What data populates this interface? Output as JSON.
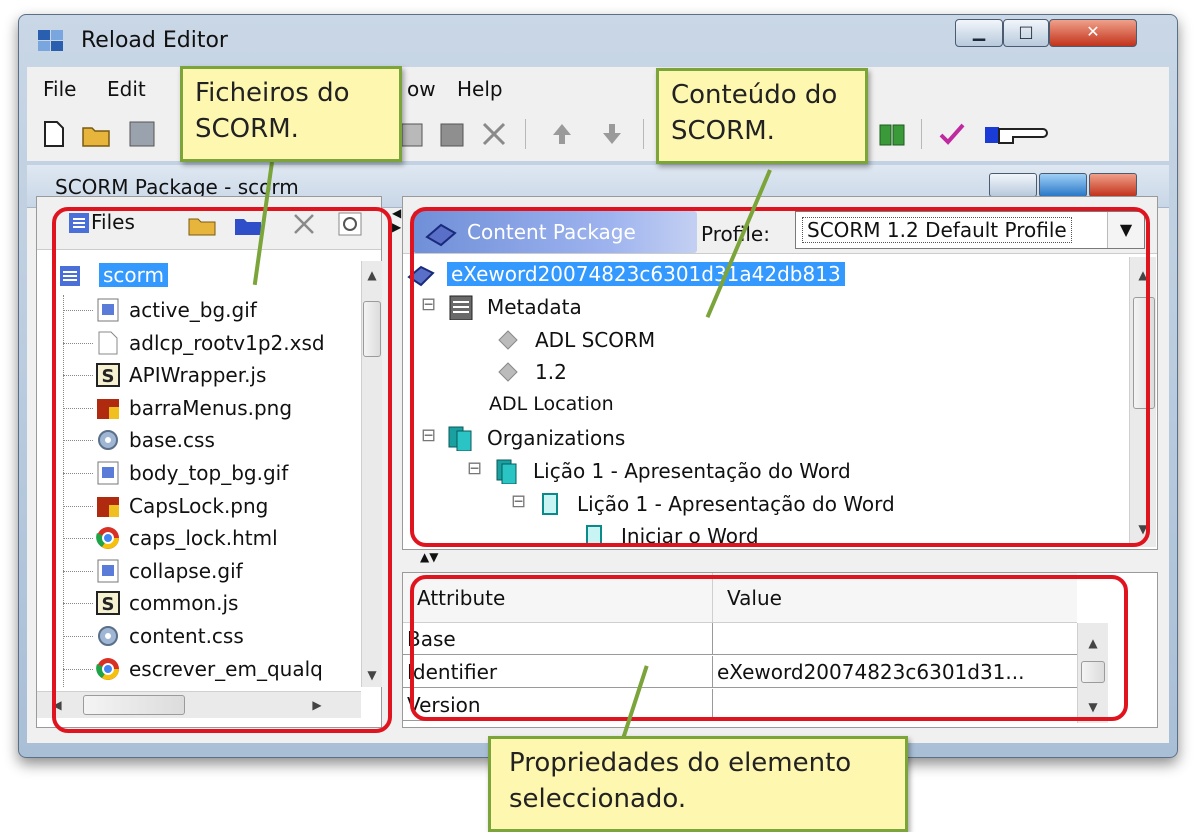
{
  "window": {
    "title": "Reload Editor"
  },
  "menu": {
    "file": "File",
    "edit": "Edit",
    "window_partial": "ow",
    "help": "Help"
  },
  "child_window": {
    "title": "SCORM Package - scorm"
  },
  "files": {
    "label": "Files",
    "root": "scorm",
    "items": [
      {
        "name": "active_bg.gif",
        "icon": "image-file-icon"
      },
      {
        "name": "adlcp_rootv1p2.xsd",
        "icon": "blank-file-icon"
      },
      {
        "name": "APIWrapper.js",
        "icon": "script-file-icon"
      },
      {
        "name": "barraMenus.png",
        "icon": "png-file-icon"
      },
      {
        "name": "base.css",
        "icon": "css-file-icon"
      },
      {
        "name": "body_top_bg.gif",
        "icon": "image-file-icon"
      },
      {
        "name": "CapsLock.png",
        "icon": "png-file-icon"
      },
      {
        "name": "caps_lock.html",
        "icon": "chrome-html-icon"
      },
      {
        "name": "collapse.gif",
        "icon": "image-file-icon"
      },
      {
        "name": "common.js",
        "icon": "script-file-icon"
      },
      {
        "name": "content.css",
        "icon": "css-file-icon"
      },
      {
        "name": "escrever_em_qualq",
        "icon": "chrome-html-icon"
      }
    ]
  },
  "content_package": {
    "tab_label": "Content Package",
    "profile_label": "Profile:",
    "profile_value": "SCORM 1.2 Default Profile",
    "tree": [
      {
        "label": "eXeword20074823c6301d31a42db813",
        "selected": true
      },
      {
        "label": "Metadata"
      },
      {
        "label": "ADL SCORM"
      },
      {
        "label": "1.2"
      },
      {
        "label": "ADL Location"
      },
      {
        "label": "Organizations"
      },
      {
        "label": "Lição 1 - Apresentação do Word"
      },
      {
        "label": "Lição 1 - Apresentação do Word"
      },
      {
        "label": "Iniciar o Word"
      }
    ]
  },
  "properties": {
    "col_attribute": "Attribute",
    "col_value": "Value",
    "rows": [
      {
        "attribute": "Base",
        "value": ""
      },
      {
        "attribute": "Identifier",
        "value": "eXeword20074823c6301d31..."
      },
      {
        "attribute": "Version",
        "value": ""
      }
    ]
  },
  "callouts": {
    "files": "Ficheiros do SCORM.",
    "content": "Conteúdo do SCORM.",
    "properties": "Propriedades do elemento seleccionado."
  },
  "colors": {
    "highlight": "#e0141e",
    "callout_bg": "#fdf7b0",
    "callout_border": "#7ba43a",
    "selection": "#3399ff"
  }
}
